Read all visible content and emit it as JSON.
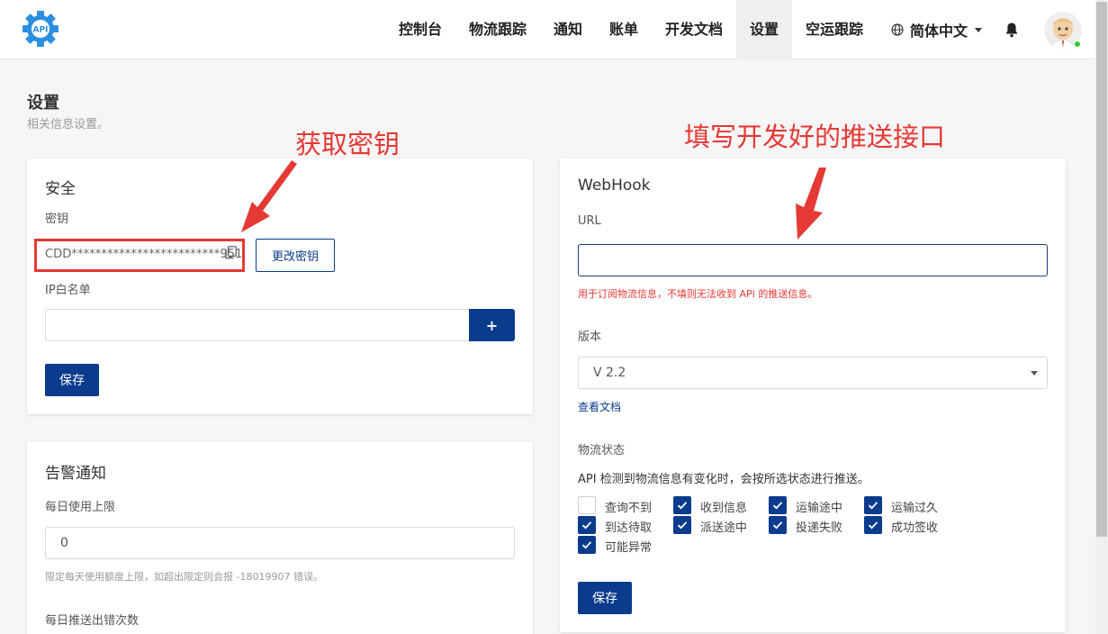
{
  "header": {
    "logo_text": "API",
    "nav": [
      {
        "label": "控制台"
      },
      {
        "label": "物流跟踪"
      },
      {
        "label": "通知"
      },
      {
        "label": "账单"
      },
      {
        "label": "开发文档"
      },
      {
        "label": "设置"
      },
      {
        "label": "空运跟踪"
      }
    ],
    "language": "简体中文"
  },
  "page": {
    "title": "设置",
    "subtitle": "相关信息设置。"
  },
  "security": {
    "title": "安全",
    "secret_label": "密钥",
    "secret_value": "CDD*************************951",
    "change_button": "更改密钥",
    "ip_label": "IP白名单",
    "ip_value": "",
    "add_button": "+",
    "save_button": "保存"
  },
  "alerts": {
    "title": "告警通知",
    "daily_limit_label": "每日使用上限",
    "daily_limit_value": "0",
    "daily_limit_hint": "限定每天使用额度上限，如超出限定则会报 -18019907 错误。",
    "push_error_label": "每日推送出错次数"
  },
  "webhook": {
    "title": "WebHook",
    "url_label": "URL",
    "url_value": "",
    "url_hint": "用于订阅物流信息，不填则无法收到 API 的推送信息。",
    "version_label": "版本",
    "version_value": "V 2.2",
    "docs_link": "查看文档",
    "status_label": "物流状态",
    "status_desc": "API 检测到物流信息有变化时，会按所选状态进行推送。",
    "statuses": [
      {
        "label": "查询不到",
        "checked": false
      },
      {
        "label": "收到信息",
        "checked": true
      },
      {
        "label": "运输途中",
        "checked": true
      },
      {
        "label": "运输过久",
        "checked": true
      },
      {
        "label": "到达待取",
        "checked": true
      },
      {
        "label": "派送途中",
        "checked": true
      },
      {
        "label": "投递失败",
        "checked": true
      },
      {
        "label": "成功签收",
        "checked": true
      },
      {
        "label": "可能异常",
        "checked": true
      }
    ],
    "save_button": "保存"
  },
  "annotations": {
    "left": "获取密钥",
    "right": "填写开发好的推送接口"
  },
  "colors": {
    "primary": "#0b3b8c",
    "annotation": "#e53935",
    "logo": "#2b8fe0"
  }
}
